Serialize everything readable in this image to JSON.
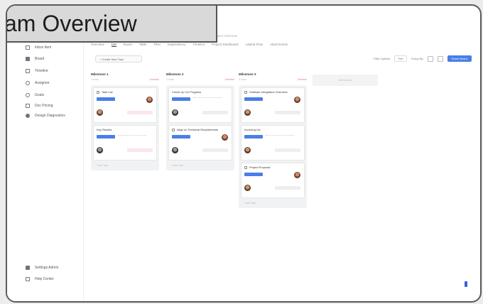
{
  "banner": {
    "title": "am Overview"
  },
  "sidebar": {
    "items": [
      {
        "label": "Inbox Item",
        "icon": "home-icon"
      },
      {
        "label": "Board",
        "icon": "board-icon"
      },
      {
        "label": "Timeline",
        "icon": "calendar-icon"
      },
      {
        "label": "Assignee",
        "icon": "user-icon"
      },
      {
        "label": "Goals",
        "icon": "target-icon"
      },
      {
        "label": "Doc Pricing",
        "icon": "doc-icon"
      },
      {
        "label": "Design Diagnostics",
        "icon": "people-icon"
      }
    ],
    "bottom": [
      {
        "label": "Settings Admin",
        "icon": "admin-icon"
      },
      {
        "label": "Help Center",
        "icon": "help-icon"
      }
    ]
  },
  "tabs": [
    "Overview",
    "List",
    "Board",
    "Table",
    "Files",
    "Dependency",
    "Timeline",
    "Project Dashboard",
    "Lateral Flow",
    "Attachments"
  ],
  "breadcrumb": "Project Overview",
  "toolbar": {
    "create_label": "+ Create New Task",
    "filters": [
      "Filter Options",
      "Sort",
      "Group By"
    ],
    "primary": "Share Board"
  },
  "columns": [
    {
      "name": "Milestone 1",
      "meta_left": "3 tasks",
      "meta_right": "Overdue",
      "footer": "+ Add Task",
      "cards": [
        {
          "title": "Task List",
          "avatar": "warm",
          "date_tone": "red"
        },
        {
          "title": "Key Results",
          "avatar": "dark",
          "date_tone": "red"
        }
      ]
    },
    {
      "name": "Milestone 2",
      "meta_left": "2 tasks",
      "meta_right": "Overdue",
      "footer": "+ Add Task",
      "cards": [
        {
          "title": "Check Up On Progress",
          "avatar": "dark",
          "date_tone": "gray"
        },
        {
          "title": "Align on Technical Requirements",
          "avatar": "dark",
          "date_tone": "gray"
        }
      ]
    },
    {
      "name": "Milestone 3",
      "meta_left": "3 tasks",
      "meta_right": "Overdue",
      "footer": "+ Add Task",
      "cards": [
        {
          "title": "Software Integration Overview",
          "avatar": "warm",
          "date_tone": "gray"
        },
        {
          "title": "Invoicing Ltd",
          "avatar": "warm",
          "date_tone": "gray"
        },
        {
          "title": "Project Proposal",
          "avatar": "warm",
          "date_tone": "gray"
        }
      ]
    }
  ],
  "add_column_label": "Add Column"
}
